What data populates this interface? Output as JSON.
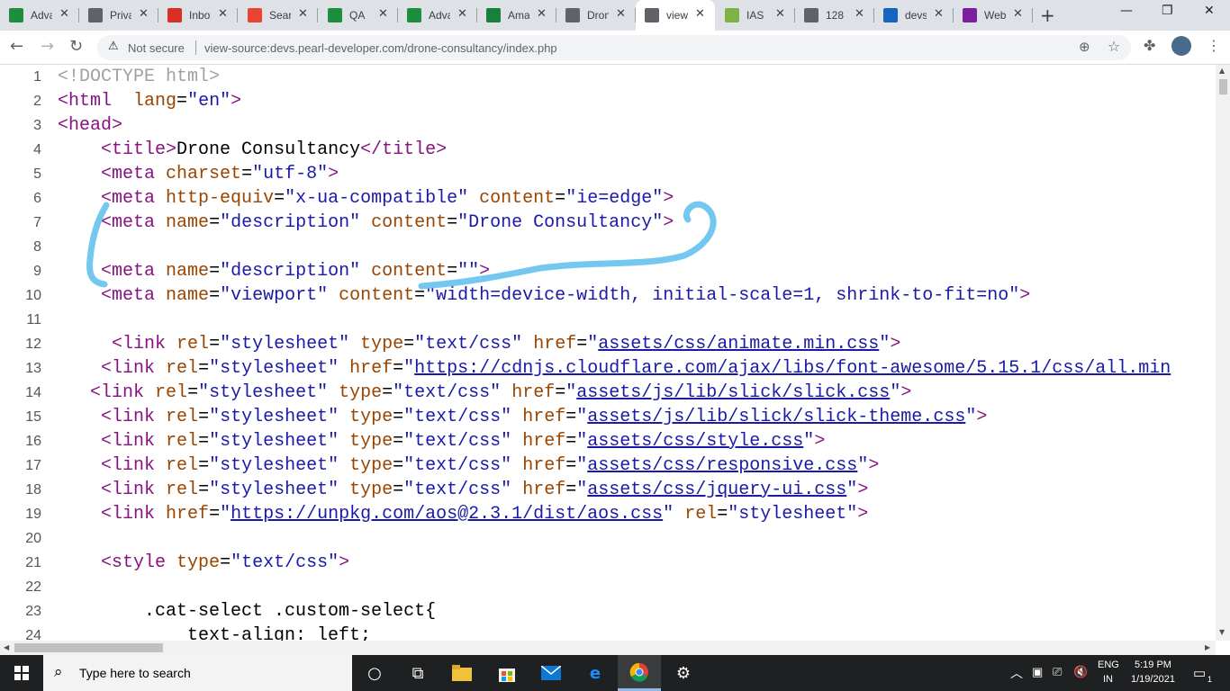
{
  "browser": {
    "tabs": [
      {
        "title": "Advanced",
        "icon": "google-sheets-icon",
        "color": "#1e8e3e"
      },
      {
        "title": "Privacy",
        "icon": "globe-icon",
        "color": "#5f6368"
      },
      {
        "title": "Inbox",
        "icon": "gmail-icon",
        "color": "#d93025"
      },
      {
        "title": "Search",
        "icon": "location-pin-icon",
        "color": "#ea4335"
      },
      {
        "title": "QA",
        "icon": "google-sheets-icon",
        "color": "#1e8e3e"
      },
      {
        "title": "Advanced",
        "icon": "google-sheets-icon",
        "color": "#1e8e3e"
      },
      {
        "title": "Amazon",
        "icon": "chat-icon",
        "color": "#188038"
      },
      {
        "title": "Drone",
        "icon": "globe-icon",
        "color": "#5f6368"
      },
      {
        "title": "view-source",
        "icon": "globe-icon",
        "color": "#5f6368",
        "active": true
      },
      {
        "title": "IAS",
        "icon": "spinner-icon",
        "color": "#7cb342"
      },
      {
        "title": "128",
        "icon": "globe-icon",
        "color": "#5f6368"
      },
      {
        "title": "devs",
        "icon": "s-logo-icon",
        "color": "#1565c0"
      },
      {
        "title": "Web",
        "icon": "window-icon",
        "color": "#7b1fa2"
      }
    ],
    "close_glyph": "✕",
    "new_tab_glyph": "+",
    "window_controls": {
      "minimize": "—",
      "restore": "❐",
      "close": "✕"
    },
    "nav": {
      "back": "←",
      "forward": "→",
      "reload": "↻"
    },
    "omnibox": {
      "security_label": "Not secure",
      "url": "view-source:devs.pearl-developer.com/drone-consultancy/index.php"
    }
  },
  "source": {
    "lines": [
      {
        "n": "1",
        "text": "<!DOCTYPE html>"
      },
      {
        "n": "2",
        "text": "<html  lang=\"en\">"
      },
      {
        "n": "3",
        "text": "<head>"
      },
      {
        "n": "4",
        "text": "    <title>Drone Consultancy</title>"
      },
      {
        "n": "5",
        "text": "    <meta charset=\"utf-8\">"
      },
      {
        "n": "6",
        "text": "    <meta http-equiv=\"x-ua-compatible\" content=\"ie=edge\">"
      },
      {
        "n": "7",
        "text": "    <meta name=\"description\" content=\"Drone Consultancy\">"
      },
      {
        "n": "8",
        "text": ""
      },
      {
        "n": "9",
        "text": "    <meta name=\"description\" content=\"\">"
      },
      {
        "n": "10",
        "text": "    <meta name=\"viewport\" content=\"width=device-width, initial-scale=1, shrink-to-fit=no\">"
      },
      {
        "n": "11",
        "text": ""
      },
      {
        "n": "12",
        "text": "     <link rel=\"stylesheet\" type=\"text/css\" href=\"assets/css/animate.min.css\">"
      },
      {
        "n": "13",
        "text": "    <link rel=\"stylesheet\" href=\"https://cdnjs.cloudflare.com/ajax/libs/font-awesome/5.15.1/css/all.min"
      },
      {
        "n": "14",
        "text": "   <link rel=\"stylesheet\" type=\"text/css\" href=\"assets/js/lib/slick/slick.css\">"
      },
      {
        "n": "15",
        "text": "    <link rel=\"stylesheet\" type=\"text/css\" href=\"assets/js/lib/slick/slick-theme.css\">"
      },
      {
        "n": "16",
        "text": "    <link rel=\"stylesheet\" type=\"text/css\" href=\"assets/css/style.css\">"
      },
      {
        "n": "17",
        "text": "    <link rel=\"stylesheet\" type=\"text/css\" href=\"assets/css/responsive.css\">"
      },
      {
        "n": "18",
        "text": "    <link rel=\"stylesheet\" type=\"text/css\" href=\"assets/css/jquery-ui.css\">"
      },
      {
        "n": "19",
        "text": "    <link href=\"https://unpkg.com/aos@2.3.1/dist/aos.css\" rel=\"stylesheet\">"
      },
      {
        "n": "20",
        "text": ""
      },
      {
        "n": "21",
        "text": "    <style type=\"text/css\">"
      },
      {
        "n": "22",
        "text": ""
      },
      {
        "n": "23",
        "text": "        .cat-select .custom-select{"
      },
      {
        "n": "24",
        "text": "            text-align: left;"
      }
    ]
  },
  "taskbar": {
    "search_placeholder": "Type here to search",
    "language": "ENG",
    "region": "IN",
    "time": "5:19 PM",
    "date": "1/19/2021",
    "notification_count": "1"
  },
  "colors": {
    "tag": "#881280",
    "attribute": "#994500",
    "value": "#1a1aa6",
    "doctype": "#a0a0a0",
    "annotation_stroke": "#74c8f0"
  }
}
